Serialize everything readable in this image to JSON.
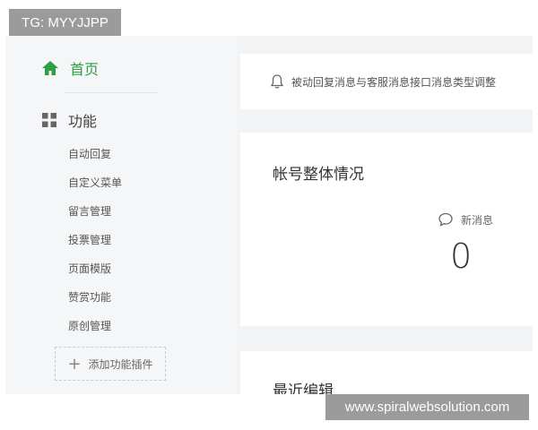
{
  "overlay": {
    "tg_label": "TG: MYYJJPP",
    "watermark": "www.spiralwebsolution.com"
  },
  "sidebar": {
    "home_label": "首页",
    "function_label": "功能",
    "sub_items": [
      "自动回复",
      "自定义菜单",
      "留言管理",
      "投票管理",
      "页面模版",
      "赞赏功能",
      "原创管理"
    ],
    "add_plugin_label": "添加功能插件",
    "home_icon": "home-icon",
    "function_icon": "grid-icon",
    "accent_color": "#2ea043"
  },
  "notice": {
    "icon": "bell-icon",
    "text": "被动回复消息与客服消息接口消息类型调整"
  },
  "overview": {
    "title": "帐号整体情况",
    "new_messages_label": "新消息",
    "new_messages_icon": "chat-bubble-icon",
    "new_messages_count": "0"
  },
  "recent": {
    "title": "最近编辑"
  }
}
